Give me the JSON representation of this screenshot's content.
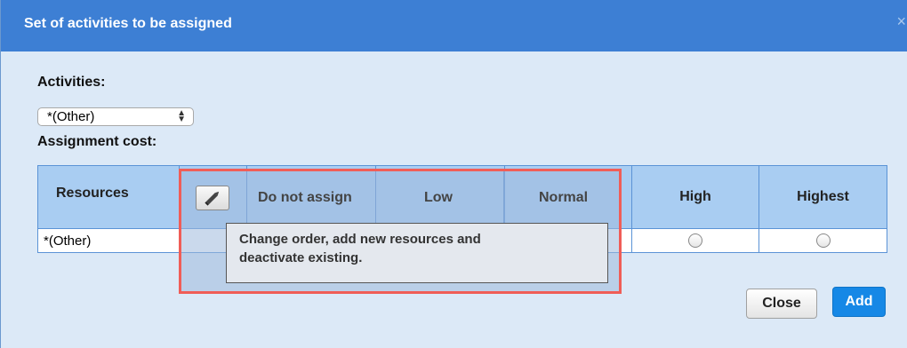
{
  "dialog": {
    "title": "Set of activities to be assigned",
    "close_glyph": "×"
  },
  "activities": {
    "label": "Activities:",
    "selected": "*(Other)"
  },
  "assignment_cost": {
    "label": "Assignment cost:"
  },
  "table": {
    "columns": [
      "Resources",
      "Do not assign",
      "Low",
      "Normal",
      "High",
      "Highest"
    ],
    "rows": [
      {
        "resource": "*(Other)"
      }
    ]
  },
  "tooltip": {
    "line1": "Change order, add new resources and",
    "line2": "deactivate existing."
  },
  "buttons": {
    "close": "Close",
    "add": "Add"
  },
  "colors": {
    "title_bar": "#3d7fd4",
    "dialog_bg": "#dce9f7",
    "header_bg": "#a9cdf2",
    "highlight_border": "#f05d57",
    "primary_button": "#1688e6"
  },
  "icons": {
    "edit": "pencil-icon",
    "close": "close-icon",
    "select_arrows": "select-arrows-icon"
  }
}
